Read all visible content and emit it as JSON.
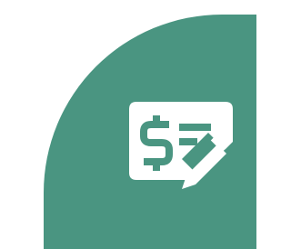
{
  "tile": {
    "color": "#4a9581"
  },
  "icon": {
    "name": "check-payment-edit-icon",
    "foreground": "#ffffff",
    "symbol": "$"
  }
}
